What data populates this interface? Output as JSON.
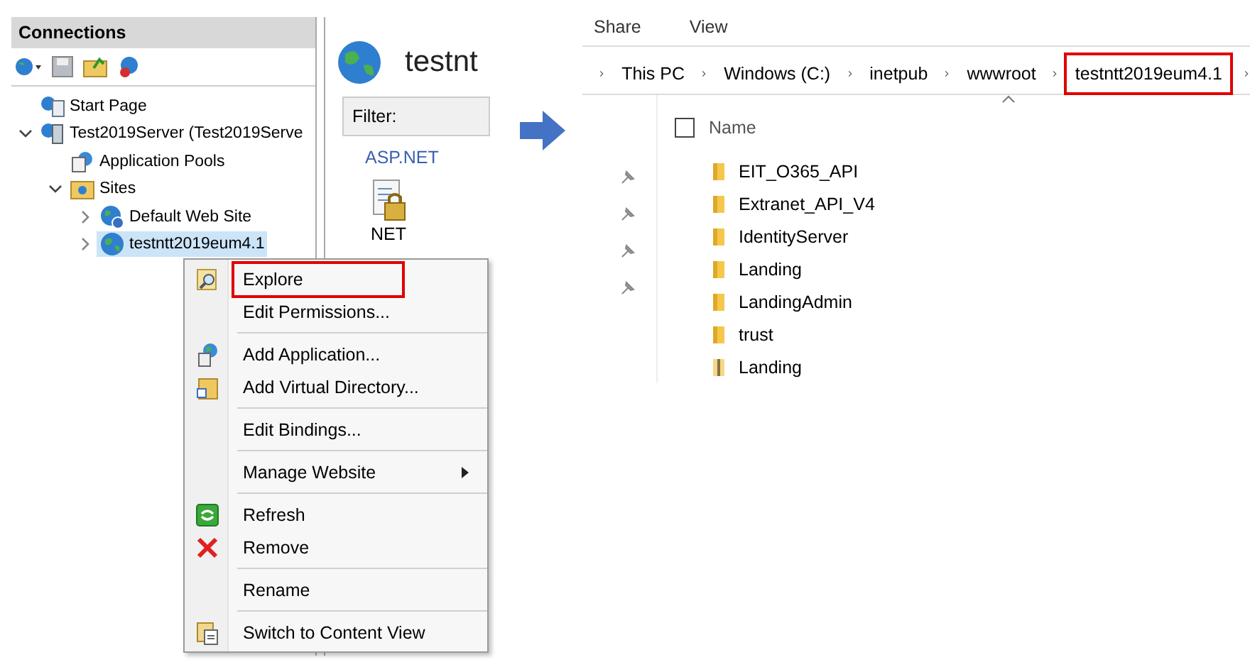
{
  "iis": {
    "connections_title": "Connections",
    "tree": [
      {
        "label": "Start Page",
        "kind": "page",
        "selected": false
      },
      {
        "label": "Test2019Server (Test2019Serve",
        "kind": "server",
        "selected": false,
        "expanded": true,
        "children": [
          {
            "label": "Application Pools",
            "kind": "pool",
            "selected": false
          },
          {
            "label": "Sites",
            "kind": "sites",
            "selected": false,
            "expanded": true,
            "children": [
              {
                "label": "Default Web Site",
                "kind": "site-default",
                "selected": false,
                "expanded": false
              },
              {
                "label": "testntt2019eum4.1",
                "kind": "site",
                "selected": true,
                "expanded": false
              }
            ]
          }
        ]
      }
    ],
    "content_title": "testnt",
    "filter_label": "Filter:",
    "group_label": "ASP.NET",
    "feature_label": "NET"
  },
  "context_menu": [
    {
      "kind": "explore",
      "label": "Explore",
      "highlighted": true
    },
    {
      "kind": "plain",
      "label": "Edit Permissions...",
      "highlighted": false
    },
    {
      "kind": "separator"
    },
    {
      "kind": "add-app",
      "label": "Add Application...",
      "highlighted": false
    },
    {
      "kind": "add-vdir",
      "label": "Add Virtual Directory...",
      "highlighted": false
    },
    {
      "kind": "separator"
    },
    {
      "kind": "plain",
      "label": "Edit Bindings...",
      "highlighted": false
    },
    {
      "kind": "separator"
    },
    {
      "kind": "plain",
      "label": "Manage Website",
      "submenu": true,
      "highlighted": false
    },
    {
      "kind": "separator"
    },
    {
      "kind": "refresh",
      "label": "Refresh",
      "highlighted": false
    },
    {
      "kind": "remove",
      "label": "Remove",
      "highlighted": false
    },
    {
      "kind": "separator"
    },
    {
      "kind": "plain",
      "label": "Rename",
      "highlighted": false
    },
    {
      "kind": "separator"
    },
    {
      "kind": "content-view",
      "label": "Switch to Content View",
      "highlighted": false
    }
  ],
  "explorer": {
    "ribbon_tabs": [
      "Share",
      "View"
    ],
    "breadcrumb": [
      {
        "label": "This PC",
        "highlighted": false
      },
      {
        "label": "Windows (C:)",
        "highlighted": false
      },
      {
        "label": "inetpub",
        "highlighted": false
      },
      {
        "label": "wwwroot",
        "highlighted": false
      },
      {
        "label": "testntt2019eum4.1",
        "highlighted": true
      }
    ],
    "column": "Name",
    "select_all_checked": false,
    "quick_access": [
      {
        "pinned": true
      },
      {
        "pinned": true
      },
      {
        "pinned": true
      },
      {
        "pinned": true
      }
    ],
    "rows": [
      {
        "name": "EIT_O365_API",
        "kind": "folder"
      },
      {
        "name": "Extranet_API_V4",
        "kind": "folder"
      },
      {
        "name": "IdentityServer",
        "kind": "folder"
      },
      {
        "name": "Landing",
        "kind": "folder"
      },
      {
        "name": "LandingAdmin",
        "kind": "folder"
      },
      {
        "name": "trust",
        "kind": "folder"
      },
      {
        "name": "Landing",
        "kind": "zip"
      }
    ]
  }
}
